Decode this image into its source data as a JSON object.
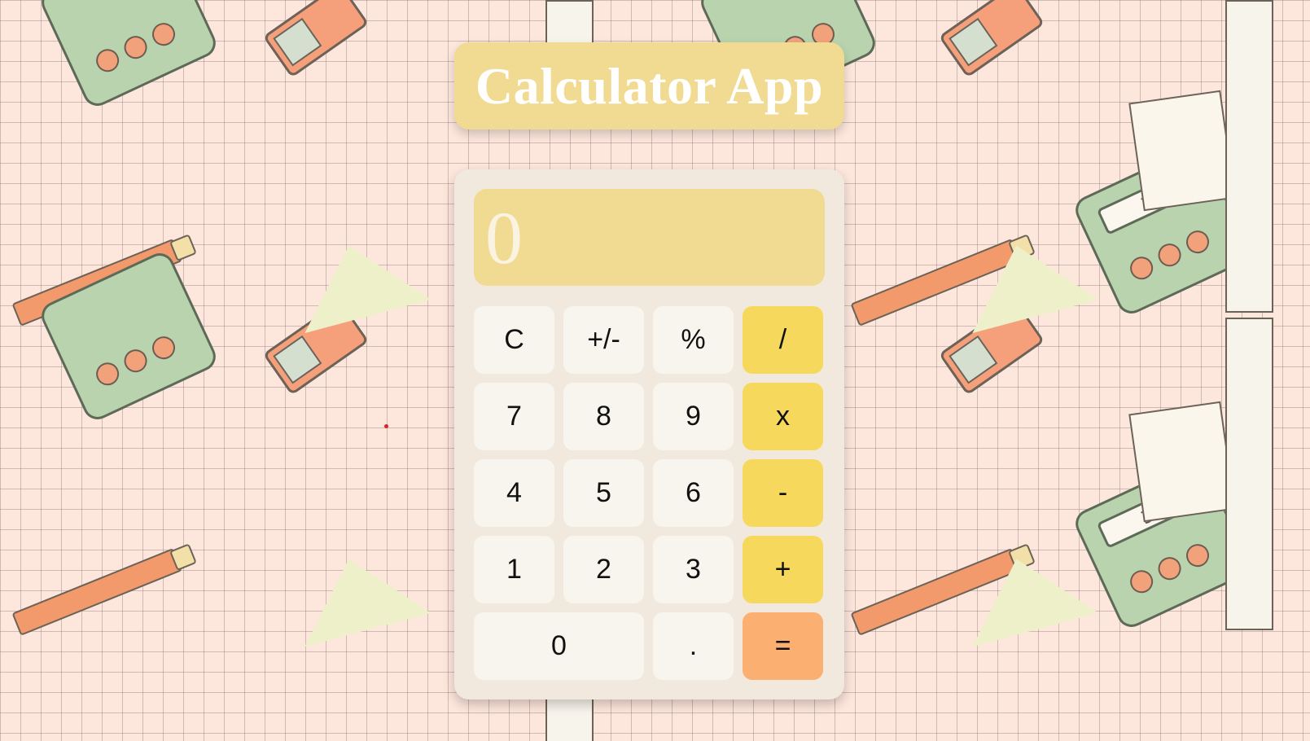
{
  "app": {
    "title": "Calculator App"
  },
  "display": {
    "value": "0"
  },
  "keys": {
    "clear": "C",
    "sign": "+/-",
    "percent": "%",
    "divide": "/",
    "seven": "7",
    "eight": "8",
    "nine": "9",
    "multiply": "x",
    "four": "4",
    "five": "5",
    "six": "6",
    "subtract": "-",
    "one": "1",
    "two": "2",
    "three": "3",
    "add": "+",
    "zero": "0",
    "decimal": ".",
    "equals": "="
  },
  "background": {
    "mini_calculator_screen": "3012"
  },
  "colors": {
    "page_background": "#fde6dc",
    "title_card": "#f1db92",
    "calculator_body": "#f1e9dd",
    "display": "#f1db92",
    "key": "#f8f5ee",
    "operator_key": "#f6d85c",
    "equals_key": "#fbaf70"
  }
}
